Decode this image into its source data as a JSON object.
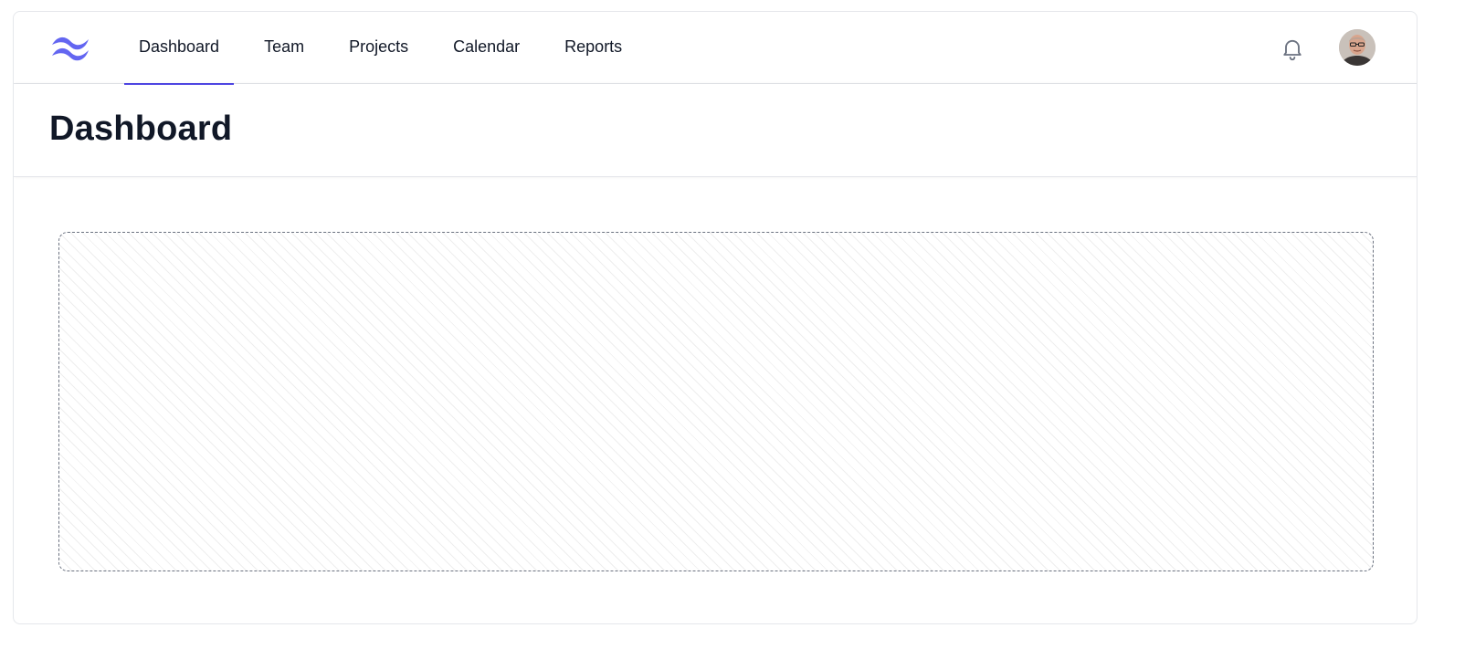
{
  "nav": {
    "tabs": [
      {
        "label": "Dashboard",
        "active": true
      },
      {
        "label": "Team",
        "active": false
      },
      {
        "label": "Projects",
        "active": false
      },
      {
        "label": "Calendar",
        "active": false
      },
      {
        "label": "Reports",
        "active": false
      }
    ],
    "icons": {
      "logo": "tailwind-logo-icon",
      "notifications": "bell-icon",
      "avatar": "user-avatar"
    }
  },
  "page": {
    "title": "Dashboard"
  },
  "colors": {
    "accent": "#4f46e5",
    "logo": "#6366f1",
    "text": "#111827",
    "border": "#e5e7eb"
  }
}
